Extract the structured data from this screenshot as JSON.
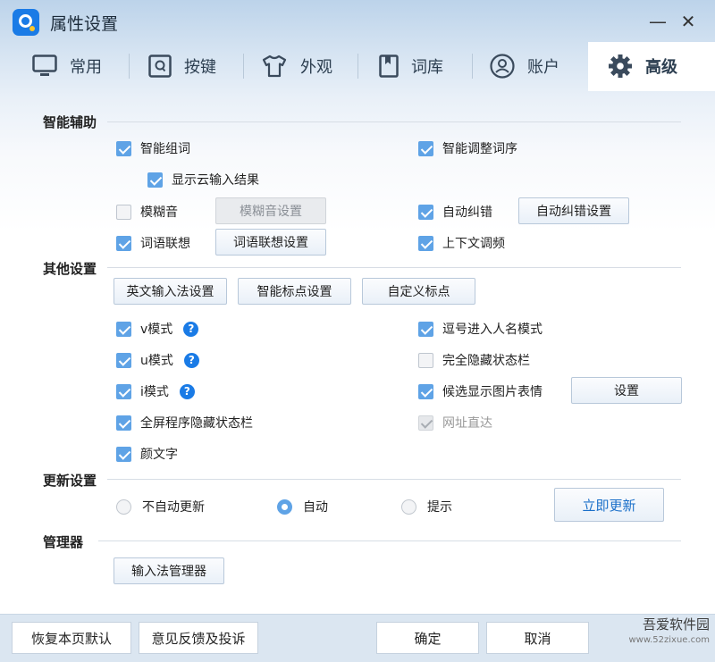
{
  "window": {
    "title": "属性设置",
    "minimize": "—",
    "close": "✕"
  },
  "tabs": [
    {
      "label": "常用",
      "icon": "monitor-icon"
    },
    {
      "label": "按键",
      "icon": "key-icon"
    },
    {
      "label": "外观",
      "icon": "shirt-icon"
    },
    {
      "label": "词库",
      "icon": "book-icon"
    },
    {
      "label": "账户",
      "icon": "user-icon"
    },
    {
      "label": "高级",
      "icon": "gear-icon",
      "active": true
    }
  ],
  "smart": {
    "title": "智能辅助",
    "smart_phrase": {
      "label": "智能组词",
      "checked": true
    },
    "smart_order": {
      "label": "智能调整词序",
      "checked": true
    },
    "cloud_result": {
      "label": "显示云输入结果",
      "checked": true
    },
    "fuzzy": {
      "label": "模糊音",
      "checked": false
    },
    "fuzzy_btn": "模糊音设置",
    "autocorrect": {
      "label": "自动纠错",
      "checked": true
    },
    "autocorrect_btn": "自动纠错设置",
    "association": {
      "label": "词语联想",
      "checked": true
    },
    "association_btn": "词语联想设置",
    "context_freq": {
      "label": "上下文调频",
      "checked": true
    }
  },
  "other": {
    "title": "其他设置",
    "btn_english": "英文输入法设置",
    "btn_punct": "智能标点设置",
    "btn_custom_punct": "自定义标点",
    "v_mode": {
      "label": "v模式",
      "checked": true
    },
    "u_mode": {
      "label": "u模式",
      "checked": true
    },
    "i_mode": {
      "label": "i模式",
      "checked": true
    },
    "help_glyph": "?",
    "fullscreen_hide": {
      "label": "全屏程序隐藏状态栏",
      "checked": true
    },
    "emoticon": {
      "label": "颜文字",
      "checked": true
    },
    "comma_name": {
      "label": "逗号进入人名模式",
      "checked": true
    },
    "hide_status": {
      "label": "完全隐藏状态栏",
      "checked": false
    },
    "candidate_img": {
      "label": "候选显示图片表情",
      "checked": true
    },
    "candidate_btn": "设置",
    "url_direct": {
      "label": "网址直达",
      "checked": true,
      "disabled": true
    }
  },
  "update": {
    "title": "更新设置",
    "options": [
      "不自动更新",
      "自动",
      "提示"
    ],
    "selected": "自动",
    "update_now": "立即更新"
  },
  "manager": {
    "title": "管理器",
    "button": "输入法管理器"
  },
  "footer": {
    "restore": "恢复本页默认",
    "feedback": "意见反馈及投诉",
    "ok": "确定",
    "cancel": "取消"
  },
  "watermark": {
    "name": "吾爱软件园",
    "url": "www.52zixue.com"
  },
  "colors": {
    "accent": "#1a7be6",
    "check": "#5fa3e6",
    "footer": "#dbe6f1"
  }
}
